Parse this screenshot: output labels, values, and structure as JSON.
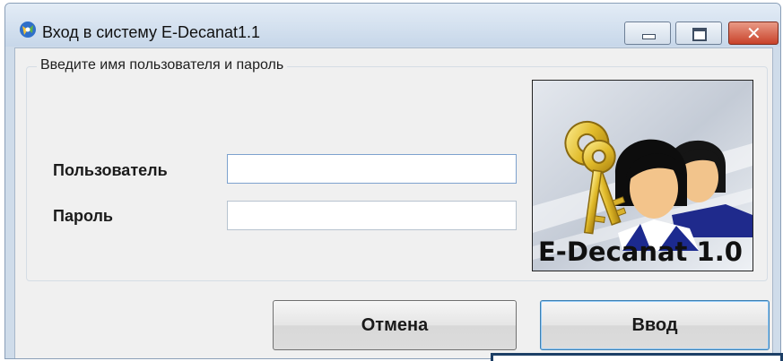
{
  "window": {
    "title": "Вход в систему E-Decanat1.1",
    "controls": {
      "minimize": "minimize",
      "maximize": "maximize",
      "close": "✕"
    }
  },
  "form": {
    "group_label": "Введите имя пользователя и пароль",
    "user_label": "Пользователь",
    "user_value": "",
    "password_label": "Пароль",
    "password_value": ""
  },
  "logo": {
    "text": "E-Decanat 1.0",
    "icon": "keys-and-users-logo"
  },
  "buttons": {
    "cancel": "Отмена",
    "ok": "Ввод"
  },
  "colors": {
    "titlebar": "#c7d7e9",
    "close_button": "#c8422a",
    "client_bg": "#f0f0f0",
    "default_button_border": "#3c7fb1"
  }
}
